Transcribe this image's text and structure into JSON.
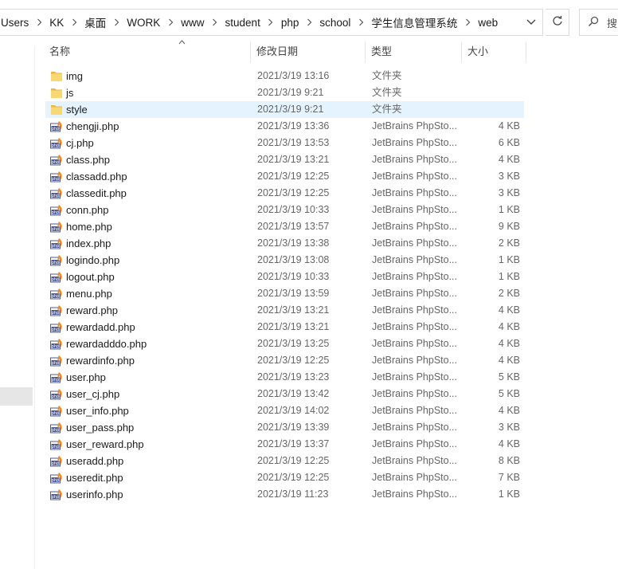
{
  "address_bar": {
    "crumbs": [
      "Users",
      "KK",
      "桌面",
      "WORK",
      "www",
      "student",
      "php",
      "school",
      "学生信息管理系统",
      "web"
    ]
  },
  "search": {
    "placeholder": "搜"
  },
  "columns": {
    "name": "名称",
    "date": "修改日期",
    "type": "类型",
    "size": "大小"
  },
  "files": [
    {
      "name": "img",
      "date": "2021/3/19 13:16",
      "type": "文件夹",
      "size": "",
      "kind": "folder"
    },
    {
      "name": "js",
      "date": "2021/3/19 9:21",
      "type": "文件夹",
      "size": "",
      "kind": "folder"
    },
    {
      "name": "style",
      "date": "2021/3/19 9:21",
      "type": "文件夹",
      "size": "",
      "kind": "folder",
      "selected": true
    },
    {
      "name": "chengji.php",
      "date": "2021/3/19 13:36",
      "type": "JetBrains PhpSto...",
      "size": "4 KB",
      "kind": "php"
    },
    {
      "name": "cj.php",
      "date": "2021/3/19 13:53",
      "type": "JetBrains PhpSto...",
      "size": "6 KB",
      "kind": "php"
    },
    {
      "name": "class.php",
      "date": "2021/3/19 13:21",
      "type": "JetBrains PhpSto...",
      "size": "4 KB",
      "kind": "php"
    },
    {
      "name": "classadd.php",
      "date": "2021/3/19 12:25",
      "type": "JetBrains PhpSto...",
      "size": "3 KB",
      "kind": "php"
    },
    {
      "name": "classedit.php",
      "date": "2021/3/19 12:25",
      "type": "JetBrains PhpSto...",
      "size": "3 KB",
      "kind": "php"
    },
    {
      "name": "conn.php",
      "date": "2021/3/19 10:33",
      "type": "JetBrains PhpSto...",
      "size": "1 KB",
      "kind": "php"
    },
    {
      "name": "home.php",
      "date": "2021/3/19 13:57",
      "type": "JetBrains PhpSto...",
      "size": "9 KB",
      "kind": "php"
    },
    {
      "name": "index.php",
      "date": "2021/3/19 13:38",
      "type": "JetBrains PhpSto...",
      "size": "2 KB",
      "kind": "php"
    },
    {
      "name": "logindo.php",
      "date": "2021/3/19 13:08",
      "type": "JetBrains PhpSto...",
      "size": "1 KB",
      "kind": "php"
    },
    {
      "name": "logout.php",
      "date": "2021/3/19 10:33",
      "type": "JetBrains PhpSto...",
      "size": "1 KB",
      "kind": "php"
    },
    {
      "name": "menu.php",
      "date": "2021/3/19 13:59",
      "type": "JetBrains PhpSto...",
      "size": "2 KB",
      "kind": "php"
    },
    {
      "name": "reward.php",
      "date": "2021/3/19 13:21",
      "type": "JetBrains PhpSto...",
      "size": "4 KB",
      "kind": "php"
    },
    {
      "name": "rewardadd.php",
      "date": "2021/3/19 13:21",
      "type": "JetBrains PhpSto...",
      "size": "4 KB",
      "kind": "php"
    },
    {
      "name": "rewardadddo.php",
      "date": "2021/3/19 13:25",
      "type": "JetBrains PhpSto...",
      "size": "4 KB",
      "kind": "php"
    },
    {
      "name": "rewardinfo.php",
      "date": "2021/3/19 12:25",
      "type": "JetBrains PhpSto...",
      "size": "4 KB",
      "kind": "php"
    },
    {
      "name": "user.php",
      "date": "2021/3/19 13:23",
      "type": "JetBrains PhpSto...",
      "size": "5 KB",
      "kind": "php"
    },
    {
      "name": "user_cj.php",
      "date": "2021/3/19 13:42",
      "type": "JetBrains PhpSto...",
      "size": "5 KB",
      "kind": "php"
    },
    {
      "name": "user_info.php",
      "date": "2021/3/19 14:02",
      "type": "JetBrains PhpSto...",
      "size": "4 KB",
      "kind": "php"
    },
    {
      "name": "user_pass.php",
      "date": "2021/3/19 13:39",
      "type": "JetBrains PhpSto...",
      "size": "3 KB",
      "kind": "php"
    },
    {
      "name": "user_reward.php",
      "date": "2021/3/19 13:37",
      "type": "JetBrains PhpSto...",
      "size": "4 KB",
      "kind": "php"
    },
    {
      "name": "useradd.php",
      "date": "2021/3/19 12:25",
      "type": "JetBrains PhpSto...",
      "size": "8 KB",
      "kind": "php"
    },
    {
      "name": "useredit.php",
      "date": "2021/3/19 12:25",
      "type": "JetBrains PhpSto...",
      "size": "7 KB",
      "kind": "php"
    },
    {
      "name": "userinfo.php",
      "date": "2021/3/19 11:23",
      "type": "JetBrains PhpSto...",
      "size": "1 KB",
      "kind": "php"
    }
  ],
  "icons": {
    "chevron": "chevron-right-icon",
    "dropdown": "chevron-down-icon",
    "refresh": "refresh-icon",
    "search": "search-icon",
    "folder": "folder-icon",
    "php": "phpstorm-file-icon"
  },
  "colors": {
    "selected_row": "#e5f3ff",
    "folder": "#f8d775",
    "php_icon": "#4f5b93",
    "php_flame": "#f08a24"
  }
}
